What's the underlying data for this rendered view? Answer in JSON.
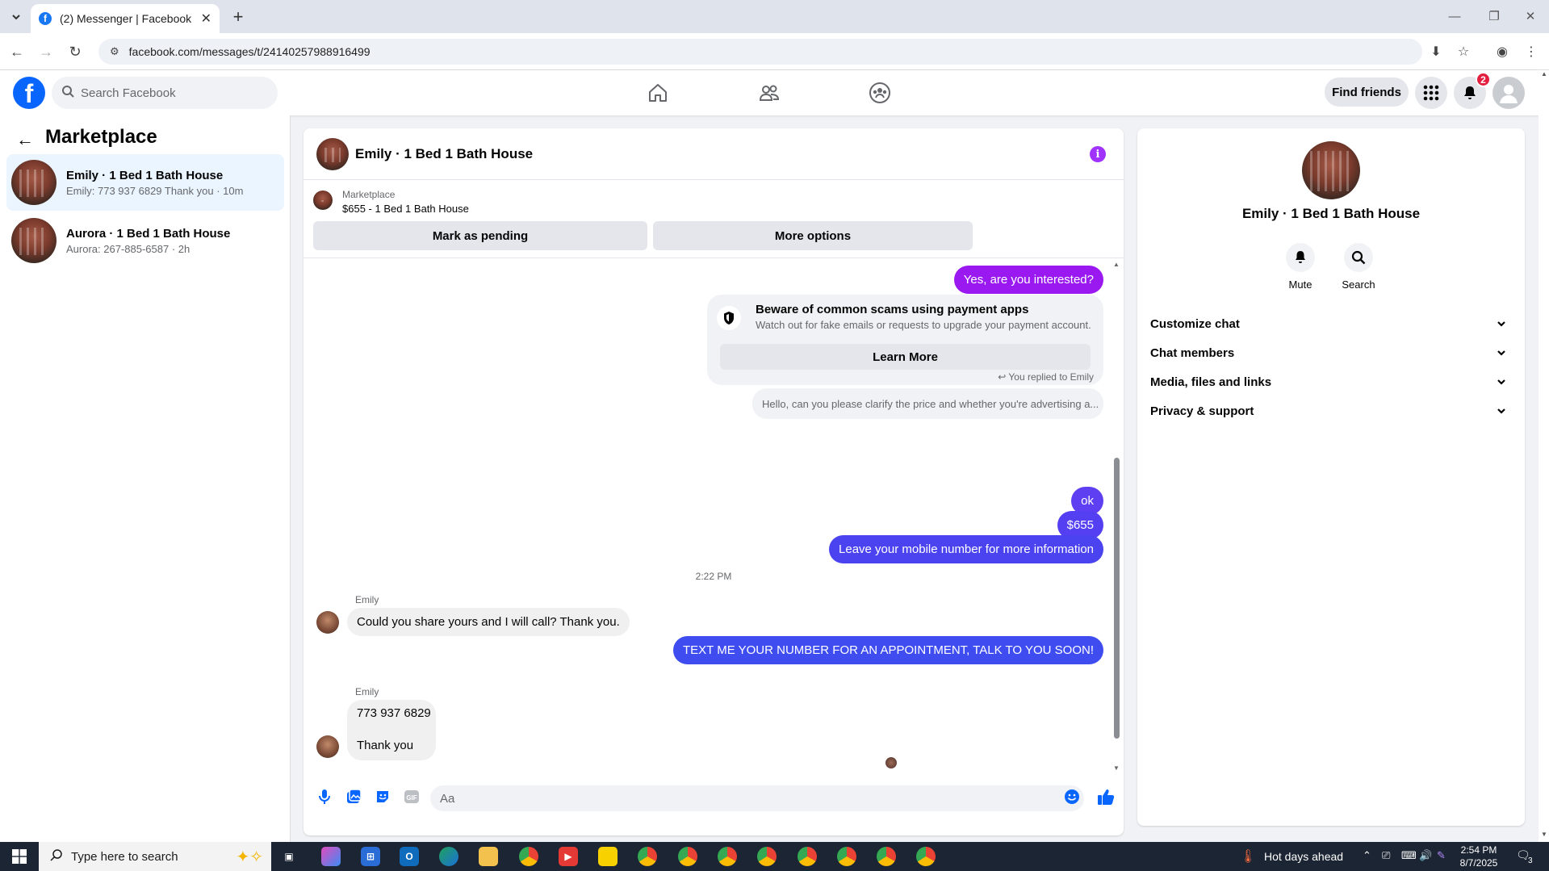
{
  "browser": {
    "tab_title": "(2) Messenger | Facebook",
    "url": "facebook.com/messages/t/24140257988916499"
  },
  "header": {
    "search_placeholder": "Search Facebook",
    "find_friends": "Find friends",
    "notification_count": "2"
  },
  "sidebar": {
    "title": "Marketplace",
    "conversations": [
      {
        "name": "Emily · 1 Bed 1 Bath House",
        "preview": "Emily: 773 937 6829 Thank you · 10m",
        "active": true
      },
      {
        "name": "Aurora · 1 Bed 1 Bath House",
        "preview": "Aurora: 267-885-6587 · 2h",
        "active": false
      }
    ]
  },
  "chat": {
    "title": "Emily · 1 Bed 1 Bath House",
    "marketplace_label": "Marketplace",
    "listing": "$655 - 1 Bed 1 Bath House",
    "mark_pending": "Mark as pending",
    "more_options": "More options",
    "messages": {
      "m1": "Yes, are you interested?",
      "scam_title": "Beware of common scams using payment apps",
      "scam_sub": "Watch out for fake emails or requests to upgrade your payment account.",
      "learn_more": "Learn More",
      "replied_to": "You replied to Emily",
      "quoted": "Hello, can you please clarify the price and whether you're advertising a...",
      "m2": "ok",
      "m3": "$655",
      "m4": "Leave your mobile number for more information",
      "time": "2:22 PM",
      "sender1": "Emily",
      "m5": "Could you share yours and I will call? Thank you.",
      "m6": "TEXT ME YOUR NUMBER FOR AN APPOINTMENT, TALK TO YOU SOON!",
      "sender2": "Emily",
      "m7": "773 937 6829",
      "m8": "Thank you"
    },
    "composer_placeholder": "Aa"
  },
  "info_panel": {
    "name": "Emily · 1 Bed 1 Bath House",
    "mute": "Mute",
    "search": "Search",
    "rows": [
      "Customize chat",
      "Chat members",
      "Media, files and links",
      "Privacy & support"
    ]
  },
  "taskbar": {
    "search_placeholder": "Type here to search",
    "weather": "Hot days ahead",
    "time": "2:54 PM",
    "date": "8/7/2025",
    "notif_count": "3"
  },
  "colors": {
    "fb_blue": "#0866ff",
    "msg_purple": "#7b30f5",
    "msg_blue": "#3e4cf0",
    "badge_red": "#e41e3f"
  }
}
